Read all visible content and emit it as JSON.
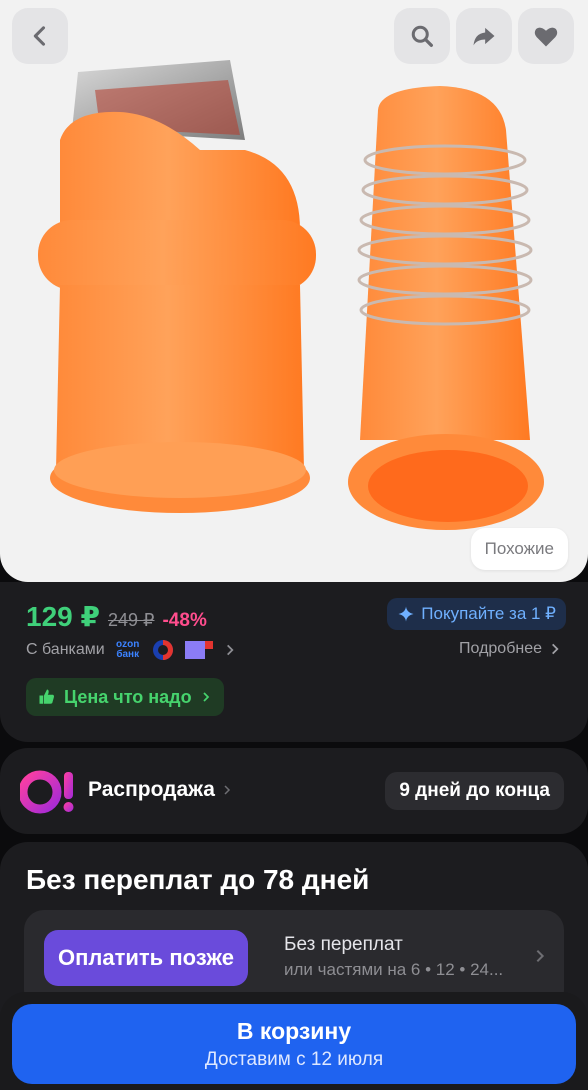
{
  "hero": {
    "similar_label": "Похожие"
  },
  "price": {
    "current": "129 ₽",
    "old": "249 ₽",
    "discount": "-48%",
    "promo_label": "Покупайте за 1 ₽",
    "banks_label": "С банками",
    "ozon_bank_line1": "ozon",
    "ozon_bank_line2": "банк",
    "more_label": "Подробнее",
    "good_price_label": "Цена что надо"
  },
  "sale": {
    "title": "Распродажа",
    "countdown": "9 дней до конца"
  },
  "installment": {
    "title": "Без переплат до 78 дней",
    "pay_later_label": "Оплатить позже",
    "line1": "Без переплат",
    "line2": "или частями на 6 • 12 • 24..."
  },
  "cart": {
    "label": "В корзину",
    "delivery": "Доставим с 12 июля"
  },
  "colors": {
    "price_green": "#3fd07a",
    "discount_pink": "#ff4d8d",
    "cart_blue": "#1f63f0",
    "pay_later_purple": "#6a4bdb"
  }
}
